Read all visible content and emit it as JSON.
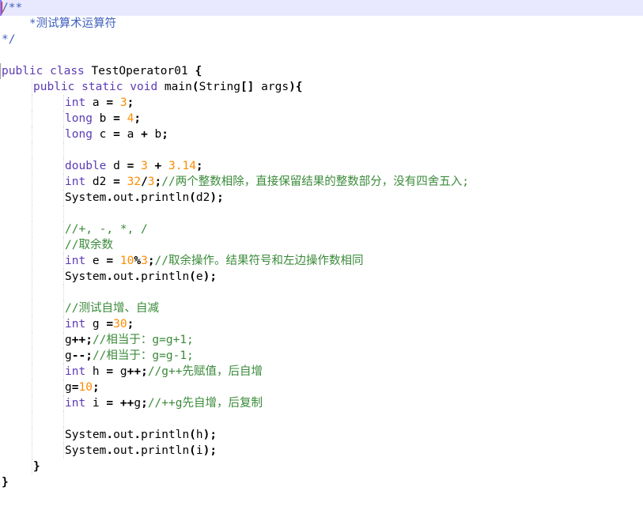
{
  "editor": {
    "language": "java",
    "colors": {
      "keyword": "#7f0055",
      "number": "#ff8c00",
      "comment": "#3a8a3a",
      "doc_comment": "#3f5fbf",
      "current_line": "#e8e8ff"
    },
    "lines": [
      {
        "indent": 0,
        "tokens": [
          {
            "t": "doc",
            "v": "/**"
          }
        ]
      },
      {
        "indent": 0,
        "tokens": [
          {
            "t": "doc",
            "v": "    *测试算术运算符"
          }
        ]
      },
      {
        "indent": 0,
        "tokens": [
          {
            "t": "doc",
            "v": "*/"
          }
        ]
      },
      {
        "indent": 0,
        "tokens": []
      },
      {
        "indent": 0,
        "tokens": [
          {
            "t": "kw2",
            "v": "public"
          },
          {
            "t": "plain",
            "v": " "
          },
          {
            "t": "kw2",
            "v": "class"
          },
          {
            "t": "plain",
            "v": " TestOperator01 "
          },
          {
            "t": "op",
            "v": "{"
          }
        ]
      },
      {
        "indent": 1,
        "tokens": [
          {
            "t": "kw2",
            "v": "public"
          },
          {
            "t": "plain",
            "v": " "
          },
          {
            "t": "kw2",
            "v": "static"
          },
          {
            "t": "plain",
            "v": " "
          },
          {
            "t": "kw2",
            "v": "void"
          },
          {
            "t": "plain",
            "v": " main"
          },
          {
            "t": "op",
            "v": "("
          },
          {
            "t": "plain",
            "v": "String"
          },
          {
            "t": "op",
            "v": "[]"
          },
          {
            "t": "plain",
            "v": " args"
          },
          {
            "t": "op",
            "v": "){"
          }
        ]
      },
      {
        "indent": 2,
        "tokens": [
          {
            "t": "kw2",
            "v": "int"
          },
          {
            "t": "plain",
            "v": " a "
          },
          {
            "t": "op",
            "v": "="
          },
          {
            "t": "plain",
            "v": " "
          },
          {
            "t": "num",
            "v": "3"
          },
          {
            "t": "op",
            "v": ";"
          }
        ]
      },
      {
        "indent": 2,
        "tokens": [
          {
            "t": "kw2",
            "v": "long"
          },
          {
            "t": "plain",
            "v": " b "
          },
          {
            "t": "op",
            "v": "="
          },
          {
            "t": "plain",
            "v": " "
          },
          {
            "t": "num",
            "v": "4"
          },
          {
            "t": "op",
            "v": ";"
          }
        ]
      },
      {
        "indent": 2,
        "tokens": [
          {
            "t": "kw2",
            "v": "long"
          },
          {
            "t": "plain",
            "v": " c "
          },
          {
            "t": "op",
            "v": "="
          },
          {
            "t": "plain",
            "v": " a "
          },
          {
            "t": "op",
            "v": "+"
          },
          {
            "t": "plain",
            "v": " b"
          },
          {
            "t": "op",
            "v": ";"
          }
        ]
      },
      {
        "indent": 2,
        "tokens": []
      },
      {
        "indent": 2,
        "tokens": [
          {
            "t": "kw2",
            "v": "double"
          },
          {
            "t": "plain",
            "v": " d "
          },
          {
            "t": "op",
            "v": "="
          },
          {
            "t": "plain",
            "v": " "
          },
          {
            "t": "num",
            "v": "3"
          },
          {
            "t": "plain",
            "v": " "
          },
          {
            "t": "op",
            "v": "+"
          },
          {
            "t": "plain",
            "v": " "
          },
          {
            "t": "num",
            "v": "3.14"
          },
          {
            "t": "op",
            "v": ";"
          }
        ]
      },
      {
        "indent": 2,
        "tokens": [
          {
            "t": "kw2",
            "v": "int"
          },
          {
            "t": "plain",
            "v": " d2 "
          },
          {
            "t": "op",
            "v": "="
          },
          {
            "t": "plain",
            "v": " "
          },
          {
            "t": "num",
            "v": "32"
          },
          {
            "t": "op",
            "v": "/"
          },
          {
            "t": "num",
            "v": "3"
          },
          {
            "t": "op",
            "v": ";"
          },
          {
            "t": "comment",
            "v": "//两个整数相除，直接保留结果的整数部分，没有四舍五入;"
          }
        ]
      },
      {
        "indent": 2,
        "tokens": [
          {
            "t": "plain",
            "v": "System"
          },
          {
            "t": "op",
            "v": "."
          },
          {
            "t": "plain",
            "v": "out"
          },
          {
            "t": "op",
            "v": "."
          },
          {
            "t": "plain",
            "v": "println"
          },
          {
            "t": "op",
            "v": "("
          },
          {
            "t": "plain",
            "v": "d2"
          },
          {
            "t": "op",
            "v": ");"
          }
        ]
      },
      {
        "indent": 2,
        "tokens": []
      },
      {
        "indent": 2,
        "tokens": [
          {
            "t": "comment",
            "v": "//+, -, *, /"
          }
        ]
      },
      {
        "indent": 2,
        "tokens": [
          {
            "t": "comment",
            "v": "//取余数"
          }
        ]
      },
      {
        "indent": 2,
        "tokens": [
          {
            "t": "kw2",
            "v": "int"
          },
          {
            "t": "plain",
            "v": " e "
          },
          {
            "t": "op",
            "v": "="
          },
          {
            "t": "plain",
            "v": " "
          },
          {
            "t": "num",
            "v": "10"
          },
          {
            "t": "op",
            "v": "%"
          },
          {
            "t": "num",
            "v": "3"
          },
          {
            "t": "op",
            "v": ";"
          },
          {
            "t": "comment",
            "v": "//取余操作。结果符号和左边操作数相同"
          }
        ]
      },
      {
        "indent": 2,
        "tokens": [
          {
            "t": "plain",
            "v": "System"
          },
          {
            "t": "op",
            "v": "."
          },
          {
            "t": "plain",
            "v": "out"
          },
          {
            "t": "op",
            "v": "."
          },
          {
            "t": "plain",
            "v": "println"
          },
          {
            "t": "op",
            "v": "("
          },
          {
            "t": "plain",
            "v": "e"
          },
          {
            "t": "op",
            "v": ");"
          }
        ]
      },
      {
        "indent": 2,
        "tokens": []
      },
      {
        "indent": 2,
        "tokens": [
          {
            "t": "comment",
            "v": "//测试自增、自减"
          }
        ]
      },
      {
        "indent": 2,
        "tokens": [
          {
            "t": "kw2",
            "v": "int"
          },
          {
            "t": "plain",
            "v": " g "
          },
          {
            "t": "op",
            "v": "="
          },
          {
            "t": "num",
            "v": "30"
          },
          {
            "t": "op",
            "v": ";"
          }
        ]
      },
      {
        "indent": 2,
        "tokens": [
          {
            "t": "plain",
            "v": "g"
          },
          {
            "t": "op",
            "v": "++;"
          },
          {
            "t": "comment",
            "v": "//相当于：g=g+1;"
          }
        ]
      },
      {
        "indent": 2,
        "tokens": [
          {
            "t": "plain",
            "v": "g"
          },
          {
            "t": "op",
            "v": "--;"
          },
          {
            "t": "comment",
            "v": "//相当于：g=g-1;"
          }
        ]
      },
      {
        "indent": 2,
        "tokens": [
          {
            "t": "kw2",
            "v": "int"
          },
          {
            "t": "plain",
            "v": " h "
          },
          {
            "t": "op",
            "v": "="
          },
          {
            "t": "plain",
            "v": " g"
          },
          {
            "t": "op",
            "v": "++;"
          },
          {
            "t": "comment",
            "v": "//g++先赋值，后自增"
          }
        ]
      },
      {
        "indent": 2,
        "tokens": [
          {
            "t": "plain",
            "v": "g"
          },
          {
            "t": "op",
            "v": "="
          },
          {
            "t": "num",
            "v": "10"
          },
          {
            "t": "op",
            "v": ";"
          }
        ]
      },
      {
        "indent": 2,
        "tokens": [
          {
            "t": "kw2",
            "v": "int"
          },
          {
            "t": "plain",
            "v": " i "
          },
          {
            "t": "op",
            "v": "="
          },
          {
            "t": "plain",
            "v": " "
          },
          {
            "t": "op",
            "v": "++"
          },
          {
            "t": "plain",
            "v": "g"
          },
          {
            "t": "op",
            "v": ";"
          },
          {
            "t": "comment",
            "v": "//++g先自增，后复制"
          }
        ]
      },
      {
        "indent": 2,
        "tokens": []
      },
      {
        "indent": 2,
        "tokens": [
          {
            "t": "plain",
            "v": "System"
          },
          {
            "t": "op",
            "v": "."
          },
          {
            "t": "plain",
            "v": "out"
          },
          {
            "t": "op",
            "v": "."
          },
          {
            "t": "plain",
            "v": "println"
          },
          {
            "t": "op",
            "v": "("
          },
          {
            "t": "plain",
            "v": "h"
          },
          {
            "t": "op",
            "v": ");"
          }
        ]
      },
      {
        "indent": 2,
        "tokens": [
          {
            "t": "plain",
            "v": "System"
          },
          {
            "t": "op",
            "v": "."
          },
          {
            "t": "plain",
            "v": "out"
          },
          {
            "t": "op",
            "v": "."
          },
          {
            "t": "plain",
            "v": "println"
          },
          {
            "t": "op",
            "v": "("
          },
          {
            "t": "plain",
            "v": "i"
          },
          {
            "t": "op",
            "v": ");"
          }
        ]
      },
      {
        "indent": 1,
        "tokens": [
          {
            "t": "op",
            "v": "}"
          }
        ]
      },
      {
        "indent": 0,
        "tokens": [
          {
            "t": "op",
            "v": "}"
          }
        ]
      }
    ]
  }
}
